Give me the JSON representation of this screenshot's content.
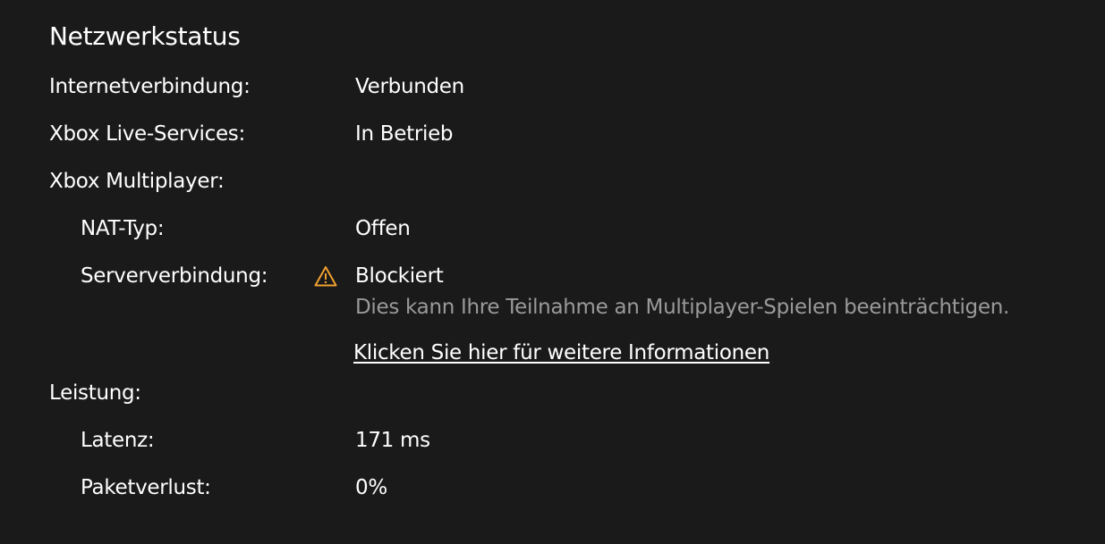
{
  "title": "Netzwerkstatus",
  "rows": {
    "internet": {
      "label": "Internetverbindung:",
      "value": "Verbunden"
    },
    "live_services": {
      "label": "Xbox Live-Services:",
      "value": "In Betrieb"
    },
    "multiplayer": {
      "label": "Xbox Multiplayer:"
    },
    "nat": {
      "label": "NAT-Typ:",
      "value": "Offen"
    },
    "server": {
      "label": "Serververbindung:",
      "value": "Blockiert",
      "note": "Dies kann Ihre Teilnahme an Multiplayer-Spielen beeinträchtigen.",
      "link": "Klicken Sie hier für weitere Informationen",
      "icon": "warning-icon"
    },
    "performance": {
      "label": "Leistung:"
    },
    "latency": {
      "label": "Latenz:",
      "value": "171 ms"
    },
    "packet_loss": {
      "label": "Paketverlust:",
      "value": "0%"
    }
  },
  "colors": {
    "background": "#1a1a1a",
    "text": "#ffffff",
    "secondary_text": "#9a9a9a",
    "warning": "#f0a030"
  }
}
